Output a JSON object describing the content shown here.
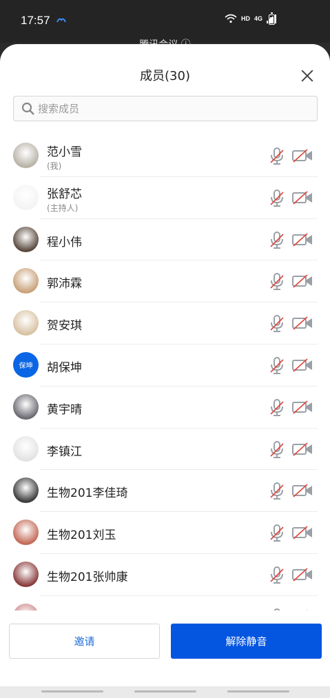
{
  "status_bar": {
    "time": "17:57",
    "hd": "HD",
    "network": "4G"
  },
  "background_title": "腾讯会议 ⓘ",
  "sheet": {
    "title": "成员(30)",
    "search_placeholder": "搜索成员"
  },
  "members": [
    {
      "name": "范小雪",
      "sub": "(我)",
      "avatar_color": "#b9b3a8"
    },
    {
      "name": "张舒芯",
      "sub": "(主持人)",
      "avatar_color": "#f4f4f4"
    },
    {
      "name": "程小伟",
      "sub": "",
      "avatar_color": "#5a4a3e"
    },
    {
      "name": "郭沛霖",
      "sub": "",
      "avatar_color": "#c9a27a"
    },
    {
      "name": "贺安琪",
      "sub": "",
      "avatar_color": "#d8c2a3"
    },
    {
      "name": "胡保坤",
      "sub": "",
      "avatar_text": "保坤",
      "avatar_color": "#0a66e4"
    },
    {
      "name": "黄宇晴",
      "sub": "",
      "avatar_color": "#6b6b73"
    },
    {
      "name": "李镇江",
      "sub": "",
      "avatar_color": "#e3e3e3"
    },
    {
      "name": "生物201李佳琦",
      "sub": "",
      "avatar_color": "#3c3c3c"
    },
    {
      "name": "生物201刘玉",
      "sub": "",
      "avatar_color": "#c46a58"
    },
    {
      "name": "生物201张帅康",
      "sub": "",
      "avatar_color": "#8a3b3b"
    },
    {
      "name": "",
      "sub": "",
      "avatar_color": "#c88"
    }
  ],
  "buttons": {
    "invite": "邀请",
    "unmute_all": "解除静音"
  },
  "colors": {
    "accent": "#0456e0",
    "muted_icon": "#9aa0a6",
    "mute_slash": "#e0433a"
  },
  "icons": {
    "mic": "mic-muted-icon",
    "camera": "camera-off-icon",
    "close": "close-icon",
    "search": "search-icon"
  }
}
